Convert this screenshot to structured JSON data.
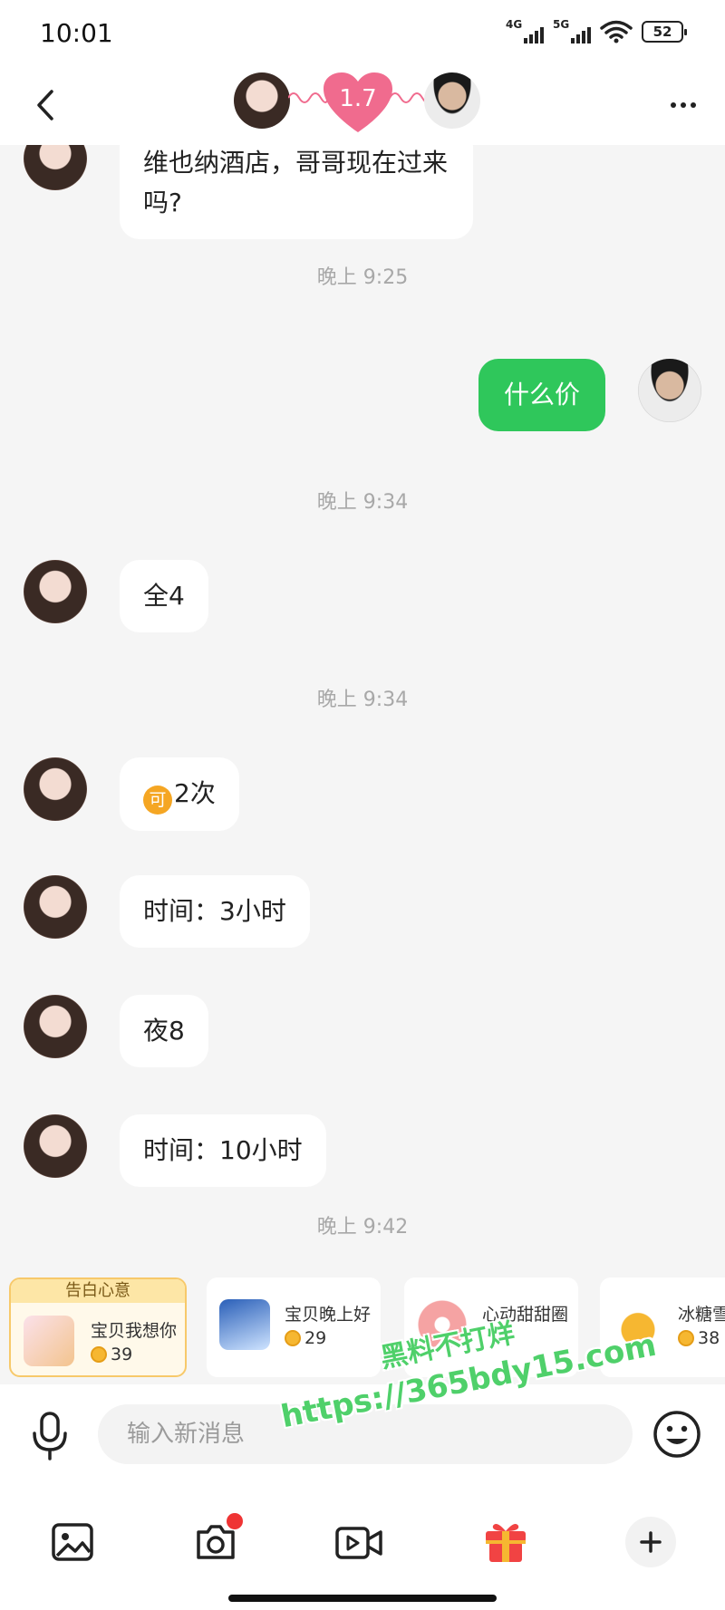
{
  "status_bar": {
    "time": "10:01",
    "signal1": "4G",
    "signal2": "5G",
    "battery": "52"
  },
  "header": {
    "intimacy": "1.7",
    "accent": "#f06b8e"
  },
  "chat": {
    "partial_message": "维也纳酒店，哥哥现在过来吗?",
    "timestamps": [
      "晚上 9:25",
      "晚上 9:34",
      "晚上 9:34",
      "晚上 9:42"
    ],
    "sent_message": "什么价",
    "received": [
      {
        "text": "全4"
      },
      {
        "icon_char": "可",
        "text": "2次"
      },
      {
        "text": "时间：3小时"
      },
      {
        "text": "夜8"
      },
      {
        "text": "时间：10小时"
      }
    ]
  },
  "gifts": {
    "tag": "告白心意",
    "items": [
      {
        "name": "宝贝我想你",
        "price": "39"
      },
      {
        "name": "宝贝晚上好",
        "price": "29"
      },
      {
        "name": "心动甜甜圈",
        "price": ""
      },
      {
        "name": "冰糖雪",
        "price": "38"
      }
    ]
  },
  "input": {
    "placeholder": "输入新消息"
  },
  "watermark": {
    "line1": "黑料不打烊",
    "line2": "https://365bdy15.com"
  },
  "colors": {
    "sent_bubble": "#2fc75b",
    "badge": "#ef3434",
    "coin": "#f6b731"
  }
}
